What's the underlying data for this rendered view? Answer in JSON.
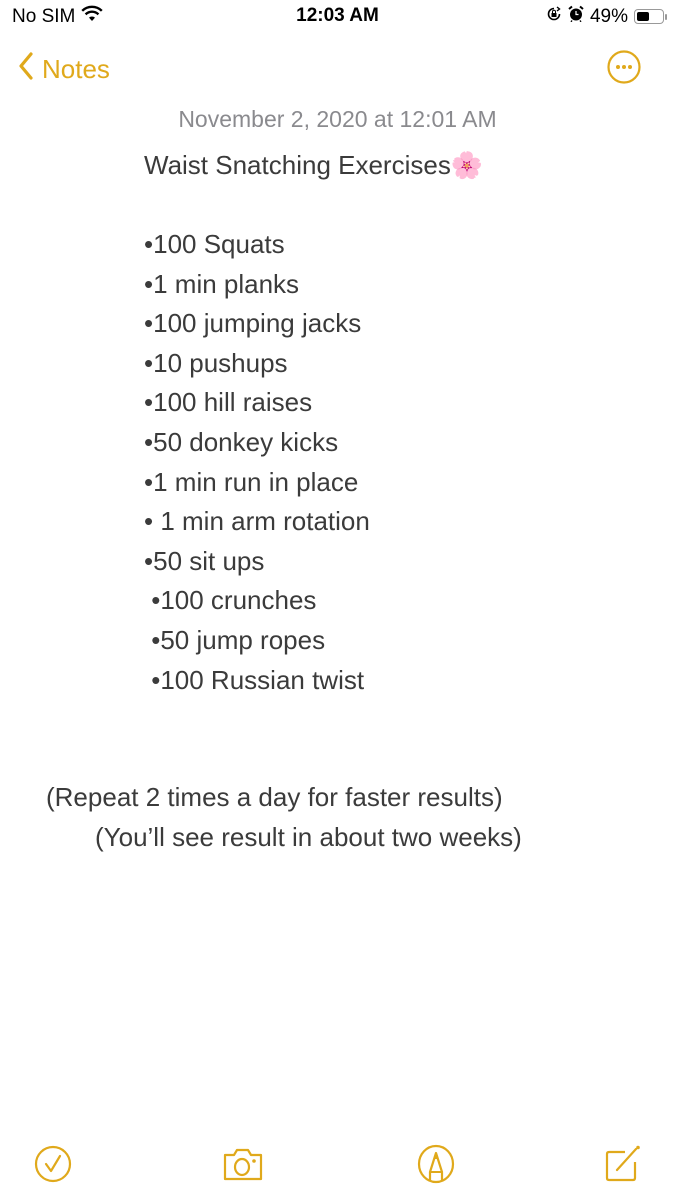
{
  "status_bar": {
    "carrier": "No SIM",
    "time": "12:03 AM",
    "battery_percent_label": "49%",
    "battery_level": 0.49,
    "icons": [
      "wifi-icon",
      "orientation-lock-icon",
      "alarm-icon",
      "battery-icon"
    ]
  },
  "nav": {
    "back_label": "Notes",
    "more_icon": "ellipsis-circle-icon"
  },
  "note": {
    "timestamp": "November 2, 2020 at 12:01 AM",
    "title": "Waist Snatching Exercises",
    "title_emoji": "🌸",
    "items": [
      "•100 Squats",
      "•1 min planks",
      "•100 jumping jacks",
      "•10 pushups",
      "•100 hill raises",
      "•50 donkey kicks",
      "•1 min run in place",
      "• 1 min arm rotation",
      "•50 sit ups",
      " •100 crunches",
      " •50 jump ropes",
      " •100 Russian twist"
    ],
    "footer_lines": [
      "(Repeat 2 times a day for faster results)",
      "(You’ll see result in about two weeks)"
    ]
  },
  "toolbar": {
    "buttons": [
      {
        "name": "checklist",
        "icon": "checkmark-circle-icon"
      },
      {
        "name": "camera",
        "icon": "camera-icon"
      },
      {
        "name": "markup",
        "icon": "pen-tip-circle-icon"
      },
      {
        "name": "compose",
        "icon": "compose-icon"
      }
    ]
  },
  "colors": {
    "accent": "#E0A91B",
    "text": "#3b3b3b",
    "timestamp": "#8a8a8e"
  }
}
